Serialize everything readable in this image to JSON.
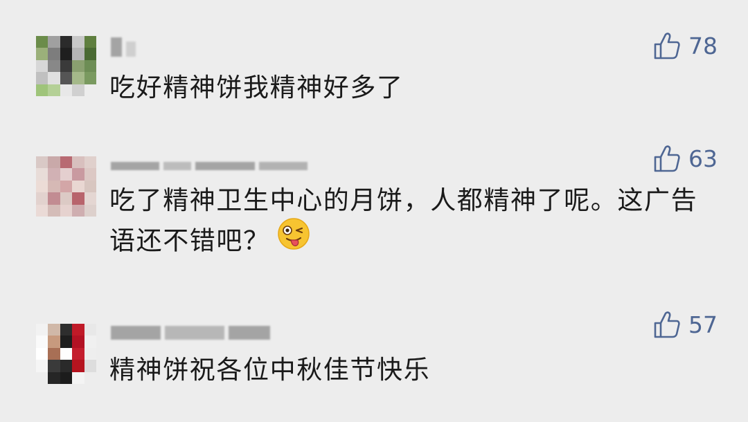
{
  "comments": [
    {
      "text": "吃好精神饼我精神好多了",
      "likes": "78",
      "avatar_colors": [
        "#6b8c4a",
        "#a0a0a0",
        "#2b2b2b",
        "#c8c8c8",
        "#5f7f3f",
        "#9bb07a",
        "#7d7d7d",
        "#1f1f1f",
        "#b5b5b5",
        "#4a6a33",
        "#d7d7d7",
        "#888888",
        "#3a3a3a",
        "#8aa070",
        "#6d8d55",
        "#c0c0c0",
        "#e0e0e0",
        "#555555",
        "#a5b98a",
        "#7a9a60",
        "#9fc47a",
        "#b4d096",
        "#e8e8e8",
        "#d0d0d0",
        "#ededed"
      ],
      "icon": "thumbs-up-icon"
    },
    {
      "text": "吃了精神卫生中心的月饼，人都精神了呢。这广告语还不错吧？",
      "likes": "63",
      "emoji": "winking-tongue-emoji",
      "avatar_colors": [
        "#d9c9c6",
        "#c9a9a9",
        "#b86a72",
        "#d8c0be",
        "#e0d0cc",
        "#e8dcd8",
        "#d1b1b4",
        "#e4cfcf",
        "#c99aa0",
        "#dcc8c4",
        "#ecdcd6",
        "#d6b9b5",
        "#d3a6a7",
        "#e9d7d2",
        "#d8c6c0",
        "#e2d2ce",
        "#c28c92",
        "#dccac5",
        "#b8646c",
        "#e4d6d2",
        "#eadad6",
        "#d4bcb8",
        "#e6d2cf",
        "#cfaeb0",
        "#ddd0cc"
      ],
      "icon": "thumbs-up-icon"
    },
    {
      "text": "精神饼祝各位中秋佳节快乐",
      "likes": "57",
      "avatar_colors": [
        "#f2f2f2",
        "#d0b8a8",
        "#2e2e2e",
        "#c01a28",
        "#e8e8e8",
        "#fafafa",
        "#c79a7e",
        "#1e1e1e",
        "#b31224",
        "#f0f0f0",
        "#ffffff",
        "#a86f55",
        "#fefefe",
        "#c41e2e",
        "#eeeeee",
        "#f5f5f5",
        "#3a3a3a",
        "#2a2a2a",
        "#b5141f",
        "#dddddd",
        "#ededed",
        "#262626",
        "#1c1c1c",
        "#f4f4f4",
        "#ededed"
      ],
      "icon": "thumbs-up-icon"
    }
  ],
  "colors": {
    "background": "#ededed",
    "text": "#1a1a1a",
    "like": "#4e6693"
  }
}
